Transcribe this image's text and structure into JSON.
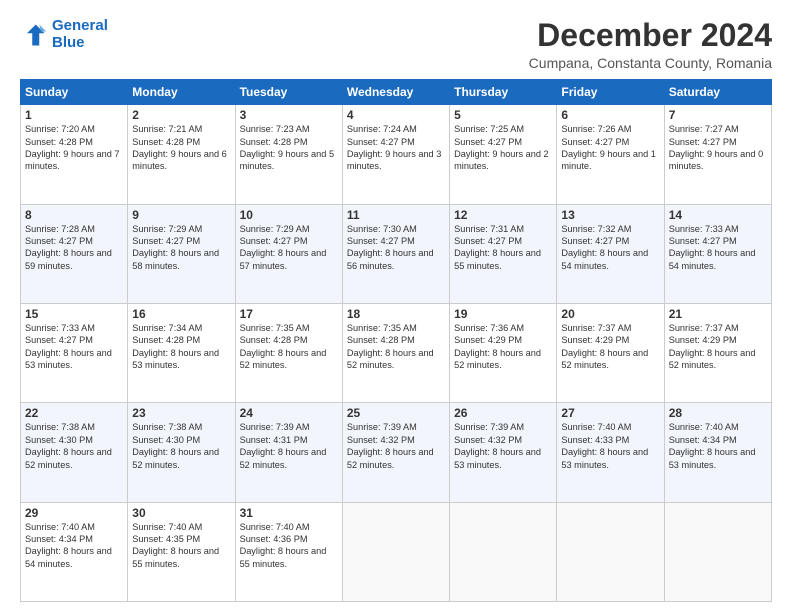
{
  "header": {
    "logo_line1": "General",
    "logo_line2": "Blue",
    "title": "December 2024",
    "subtitle": "Cumpana, Constanta County, Romania"
  },
  "columns": [
    "Sunday",
    "Monday",
    "Tuesday",
    "Wednesday",
    "Thursday",
    "Friday",
    "Saturday"
  ],
  "weeks": [
    [
      {
        "day": "1",
        "sunrise": "7:20 AM",
        "sunset": "4:28 PM",
        "daylight": "9 hours and 7 minutes."
      },
      {
        "day": "2",
        "sunrise": "7:21 AM",
        "sunset": "4:28 PM",
        "daylight": "9 hours and 6 minutes."
      },
      {
        "day": "3",
        "sunrise": "7:23 AM",
        "sunset": "4:28 PM",
        "daylight": "9 hours and 5 minutes."
      },
      {
        "day": "4",
        "sunrise": "7:24 AM",
        "sunset": "4:27 PM",
        "daylight": "9 hours and 3 minutes."
      },
      {
        "day": "5",
        "sunrise": "7:25 AM",
        "sunset": "4:27 PM",
        "daylight": "9 hours and 2 minutes."
      },
      {
        "day": "6",
        "sunrise": "7:26 AM",
        "sunset": "4:27 PM",
        "daylight": "9 hours and 1 minute."
      },
      {
        "day": "7",
        "sunrise": "7:27 AM",
        "sunset": "4:27 PM",
        "daylight": "9 hours and 0 minutes."
      }
    ],
    [
      {
        "day": "8",
        "sunrise": "7:28 AM",
        "sunset": "4:27 PM",
        "daylight": "8 hours and 59 minutes."
      },
      {
        "day": "9",
        "sunrise": "7:29 AM",
        "sunset": "4:27 PM",
        "daylight": "8 hours and 58 minutes."
      },
      {
        "day": "10",
        "sunrise": "7:29 AM",
        "sunset": "4:27 PM",
        "daylight": "8 hours and 57 minutes."
      },
      {
        "day": "11",
        "sunrise": "7:30 AM",
        "sunset": "4:27 PM",
        "daylight": "8 hours and 56 minutes."
      },
      {
        "day": "12",
        "sunrise": "7:31 AM",
        "sunset": "4:27 PM",
        "daylight": "8 hours and 55 minutes."
      },
      {
        "day": "13",
        "sunrise": "7:32 AM",
        "sunset": "4:27 PM",
        "daylight": "8 hours and 54 minutes."
      },
      {
        "day": "14",
        "sunrise": "7:33 AM",
        "sunset": "4:27 PM",
        "daylight": "8 hours and 54 minutes."
      }
    ],
    [
      {
        "day": "15",
        "sunrise": "7:33 AM",
        "sunset": "4:27 PM",
        "daylight": "8 hours and 53 minutes."
      },
      {
        "day": "16",
        "sunrise": "7:34 AM",
        "sunset": "4:28 PM",
        "daylight": "8 hours and 53 minutes."
      },
      {
        "day": "17",
        "sunrise": "7:35 AM",
        "sunset": "4:28 PM",
        "daylight": "8 hours and 52 minutes."
      },
      {
        "day": "18",
        "sunrise": "7:35 AM",
        "sunset": "4:28 PM",
        "daylight": "8 hours and 52 minutes."
      },
      {
        "day": "19",
        "sunrise": "7:36 AM",
        "sunset": "4:29 PM",
        "daylight": "8 hours and 52 minutes."
      },
      {
        "day": "20",
        "sunrise": "7:37 AM",
        "sunset": "4:29 PM",
        "daylight": "8 hours and 52 minutes."
      },
      {
        "day": "21",
        "sunrise": "7:37 AM",
        "sunset": "4:29 PM",
        "daylight": "8 hours and 52 minutes."
      }
    ],
    [
      {
        "day": "22",
        "sunrise": "7:38 AM",
        "sunset": "4:30 PM",
        "daylight": "8 hours and 52 minutes."
      },
      {
        "day": "23",
        "sunrise": "7:38 AM",
        "sunset": "4:30 PM",
        "daylight": "8 hours and 52 minutes."
      },
      {
        "day": "24",
        "sunrise": "7:39 AM",
        "sunset": "4:31 PM",
        "daylight": "8 hours and 52 minutes."
      },
      {
        "day": "25",
        "sunrise": "7:39 AM",
        "sunset": "4:32 PM",
        "daylight": "8 hours and 52 minutes."
      },
      {
        "day": "26",
        "sunrise": "7:39 AM",
        "sunset": "4:32 PM",
        "daylight": "8 hours and 53 minutes."
      },
      {
        "day": "27",
        "sunrise": "7:40 AM",
        "sunset": "4:33 PM",
        "daylight": "8 hours and 53 minutes."
      },
      {
        "day": "28",
        "sunrise": "7:40 AM",
        "sunset": "4:34 PM",
        "daylight": "8 hours and 53 minutes."
      }
    ],
    [
      {
        "day": "29",
        "sunrise": "7:40 AM",
        "sunset": "4:34 PM",
        "daylight": "8 hours and 54 minutes."
      },
      {
        "day": "30",
        "sunrise": "7:40 AM",
        "sunset": "4:35 PM",
        "daylight": "8 hours and 55 minutes."
      },
      {
        "day": "31",
        "sunrise": "7:40 AM",
        "sunset": "4:36 PM",
        "daylight": "8 hours and 55 minutes."
      },
      null,
      null,
      null,
      null
    ]
  ]
}
